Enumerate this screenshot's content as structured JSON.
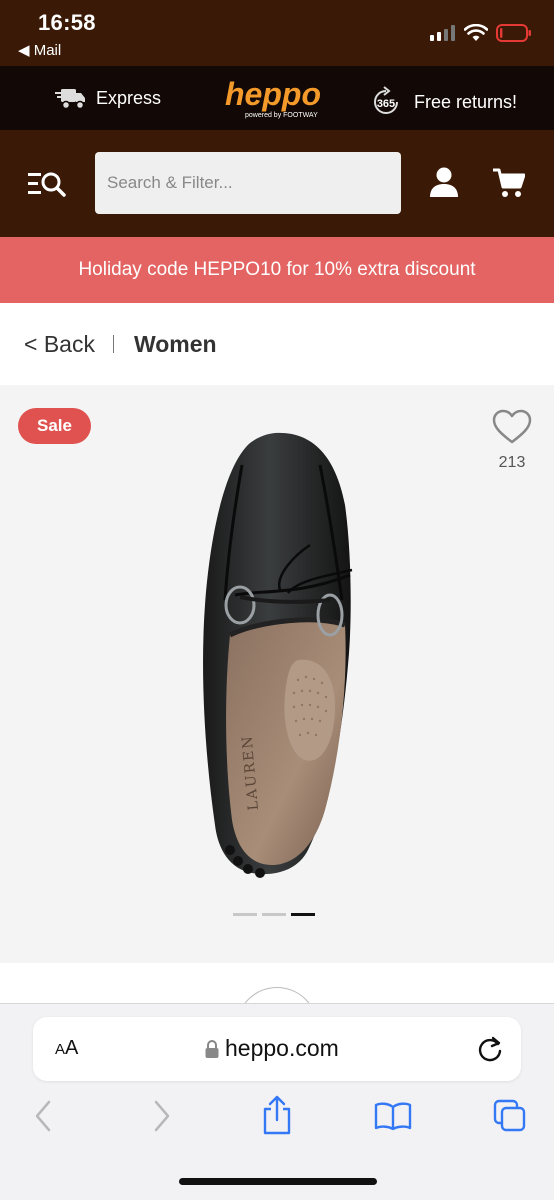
{
  "status_bar": {
    "time": "16:58",
    "back_app": "◀ Mail",
    "icons": [
      "signal-icon",
      "wifi-icon",
      "battery-icon"
    ],
    "battery_level": 0.1,
    "battery_color": "#e53935"
  },
  "promo_strip": {
    "express_label": "Express",
    "logo_text": "heppo",
    "logo_tagline": "powered by FOOTWAY",
    "returns_badge": "365",
    "returns_label": "Free returns!"
  },
  "nav": {
    "search_placeholder": "Search & Filter...",
    "icons": [
      "menu-search-icon",
      "account-icon",
      "cart-icon"
    ]
  },
  "banner": {
    "text": "Holiday code HEPPO10 for 10% extra discount"
  },
  "breadcrumb": {
    "back": "< Back",
    "current": "Women"
  },
  "product": {
    "badge": "Sale",
    "likes": "213",
    "image_brand_text": "LAUREN",
    "carousel": {
      "count": 3,
      "active_index": 2
    }
  },
  "browser": {
    "text_size_label": "AA",
    "url": "heppo.com",
    "toolbar": [
      "back-icon",
      "forward-icon",
      "share-icon",
      "bookmarks-icon",
      "tabs-icon"
    ]
  },
  "colors": {
    "header_brown": "#3a1a06",
    "promo_black": "#120805",
    "brand_orange": "#f39a2b",
    "banner_red": "#e36462",
    "sale_red": "#e0524f",
    "ios_blue": "#3478f6"
  }
}
